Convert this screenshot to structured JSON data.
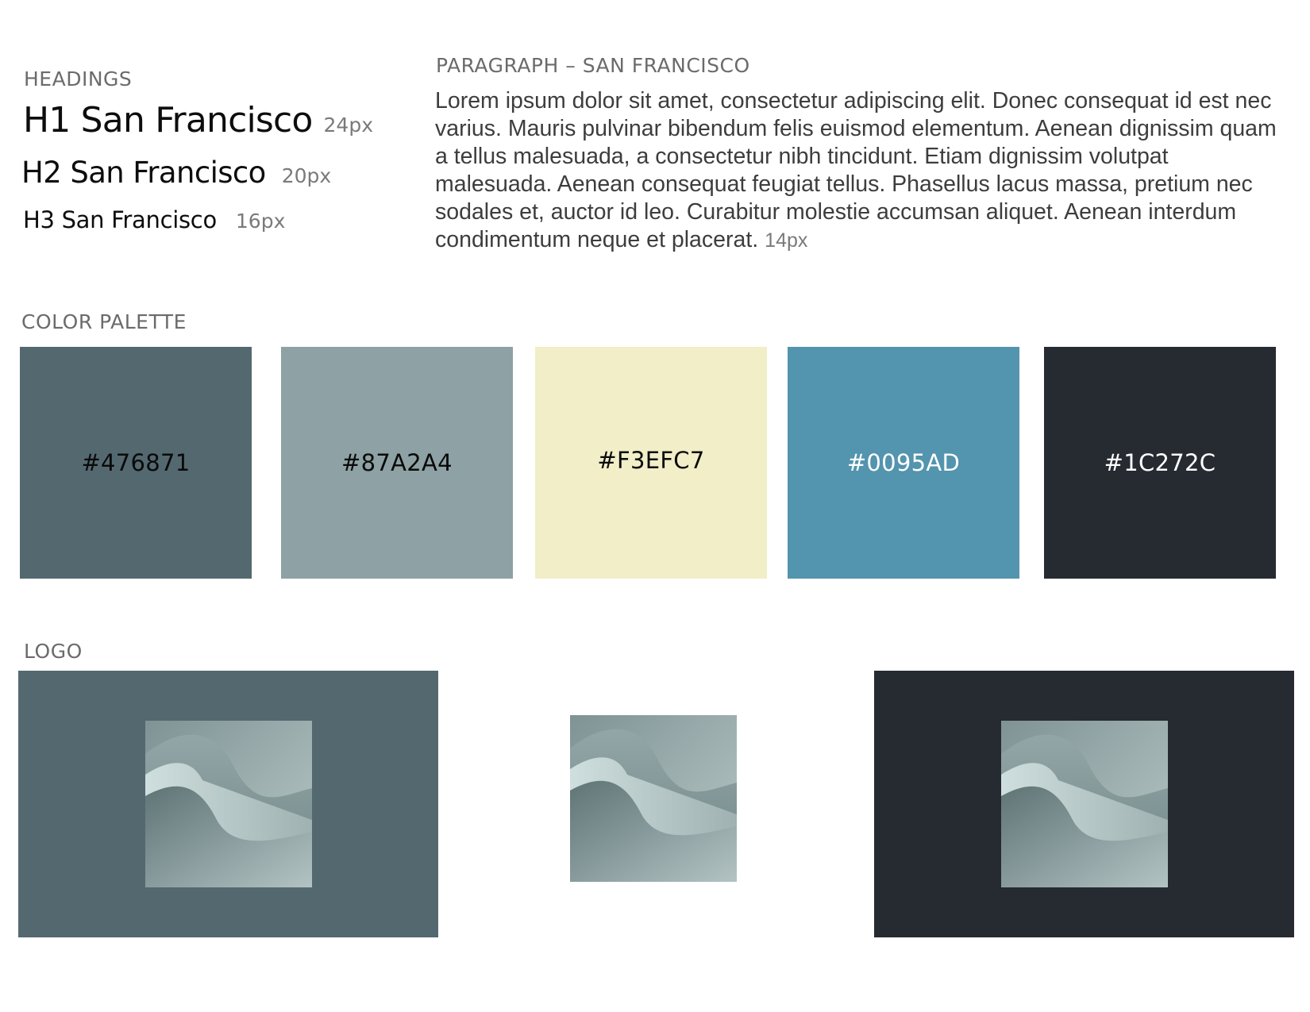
{
  "headings": {
    "label": "HEADINGS",
    "h1": {
      "name": "H1 San Francisco",
      "size": "24px"
    },
    "h2": {
      "name": "H2 San Francisco",
      "size": "20px"
    },
    "h3": {
      "name": "H3 San Francisco",
      "size": "16px"
    }
  },
  "paragraph": {
    "label": "PARAGRAPH – SAN FRANCISCO",
    "text": "Lorem ipsum dolor sit amet, consectetur adipiscing elit. Donec consequat id est nec varius. Mauris pulvinar bibendum felis euismod elementum. Aenean dignissim quam a tellus malesuada, a consectetur nibh tincidunt. Etiam dignissim volutpat malesuada. Aenean consequat feugiat tellus. Phasellus lacus massa, pretium nec sodales et, auctor id leo. Curabitur molestie accumsan aliquet. Aenean interdum condimentum neque et placerat.",
    "size": "14px"
  },
  "palette": {
    "label": "COLOR PALETTE",
    "swatches": [
      {
        "hex": "#476871",
        "text_color": "#0a0a0a"
      },
      {
        "hex": "#87A2A4",
        "text_color": "#0a0a0a"
      },
      {
        "hex": "#F3EFC7",
        "text_color": "#0a0a0a"
      },
      {
        "hex": "#0095AD",
        "text_color": "#ffffff"
      },
      {
        "hex": "#1C272C",
        "text_color": "#ffffff"
      }
    ],
    "display_fills": [
      "#546870",
      "#8ea1a4",
      "#f1eec8",
      "#5394ae",
      "#262a31"
    ]
  },
  "logo": {
    "label": "LOGO",
    "panels": [
      {
        "background": "#546870",
        "icon": "wave-logo-icon"
      },
      {
        "background": "#ffffff",
        "icon": "wave-logo-icon"
      },
      {
        "background": "#262a31",
        "icon": "wave-logo-icon"
      }
    ]
  }
}
